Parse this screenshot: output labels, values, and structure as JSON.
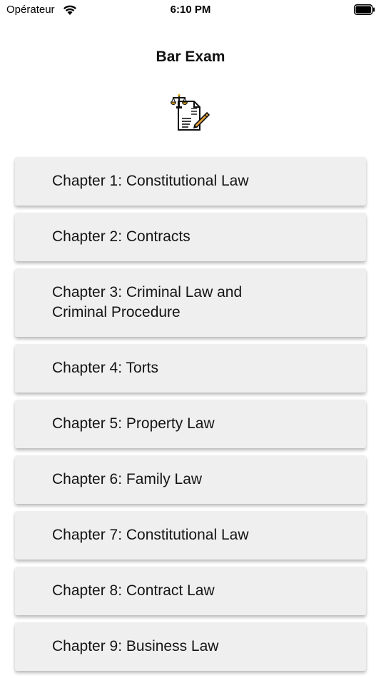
{
  "status_bar": {
    "carrier": "Opérateur",
    "time": "6:10 PM"
  },
  "header": {
    "title": "Bar Exam",
    "logo_icon": "scales-of-justice-document-pen-icon"
  },
  "chapters": [
    {
      "label": "Chapter 1: Constitutional Law"
    },
    {
      "label": "Chapter 2: Contracts"
    },
    {
      "label": "Chapter 3: Criminal Law and Criminal Procedure"
    },
    {
      "label": "Chapter 4: Torts"
    },
    {
      "label": "Chapter 5: Property Law"
    },
    {
      "label": "Chapter 6: Family Law"
    },
    {
      "label": "Chapter 7: Constitutional Law"
    },
    {
      "label": "Chapter 8: Contract Law"
    },
    {
      "label": "Chapter 9: Business Law"
    }
  ],
  "colors": {
    "card_background": "#efefef",
    "text": "#141414"
  }
}
